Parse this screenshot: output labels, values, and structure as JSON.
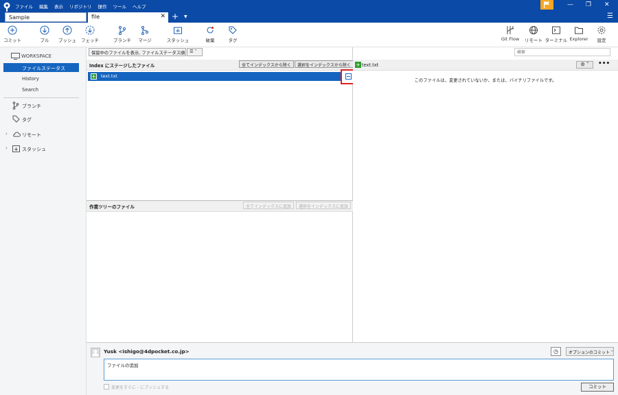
{
  "menu": [
    "ファイル",
    "編集",
    "表示",
    "リポジトリ",
    "操作",
    "ツール",
    "ヘルプ"
  ],
  "tabs": {
    "repo": "Sample",
    "file": "file"
  },
  "toolbar_left": [
    {
      "label": "コミット",
      "icon": "commit-icon"
    },
    {
      "label": "プル",
      "icon": "pull-icon"
    },
    {
      "label": "プッシュ",
      "icon": "push-icon"
    },
    {
      "label": "フェッチ",
      "icon": "fetch-icon"
    },
    {
      "label": "ブランチ",
      "icon": "branch-icon"
    },
    {
      "label": "マージ",
      "icon": "merge-icon"
    },
    {
      "label": "スタッシュ",
      "icon": "stash-icon"
    },
    {
      "label": "破棄",
      "icon": "discard-icon"
    },
    {
      "label": "タグ",
      "icon": "tag-icon"
    }
  ],
  "toolbar_right": [
    {
      "label": "Git Flow",
      "icon": "git-flow-icon"
    },
    {
      "label": "リモート",
      "icon": "remote-icon"
    },
    {
      "label": "ターミナル",
      "icon": "terminal-icon"
    },
    {
      "label": "Explorer",
      "icon": "explorer-icon"
    },
    {
      "label": "設定",
      "icon": "settings-icon"
    }
  ],
  "sidebar": {
    "workspace": "WORKSPACE",
    "items": [
      "ファイルステータス",
      "History",
      "Search"
    ],
    "sections": [
      "ブランチ",
      "タグ",
      "リモート",
      "スタッシュ"
    ]
  },
  "filter": {
    "dropdown": "保留中のファイルを表示, ファイルステータス順",
    "search_placeholder": "検索"
  },
  "staged": {
    "title": "Index にステージしたファイル",
    "btn_all": "全てインデックスから除く",
    "btn_sel": "選択をインデックスから除く",
    "files": [
      "text.txt"
    ]
  },
  "unstaged": {
    "title": "作業ツリーのファイル",
    "btn_all": "全てインデックスに追加",
    "btn_sel": "選択をインデックスに追加"
  },
  "diff": {
    "filename": "text.txt",
    "message": "このファイルは、変更されていないか、または、バイナリファイルです。"
  },
  "commit": {
    "author": "Yusk <ishigo@4dpocket.co.jp>",
    "options": "オプションのコミット",
    "message": "ファイルの追加",
    "push_label": "変更をすぐに - にプッシュする",
    "button": "コミット"
  },
  "colors": {
    "accent": "#1565c0",
    "titlebar": "#0b4aa6",
    "added": "#2e9d2e",
    "highlight": "#e02020"
  }
}
